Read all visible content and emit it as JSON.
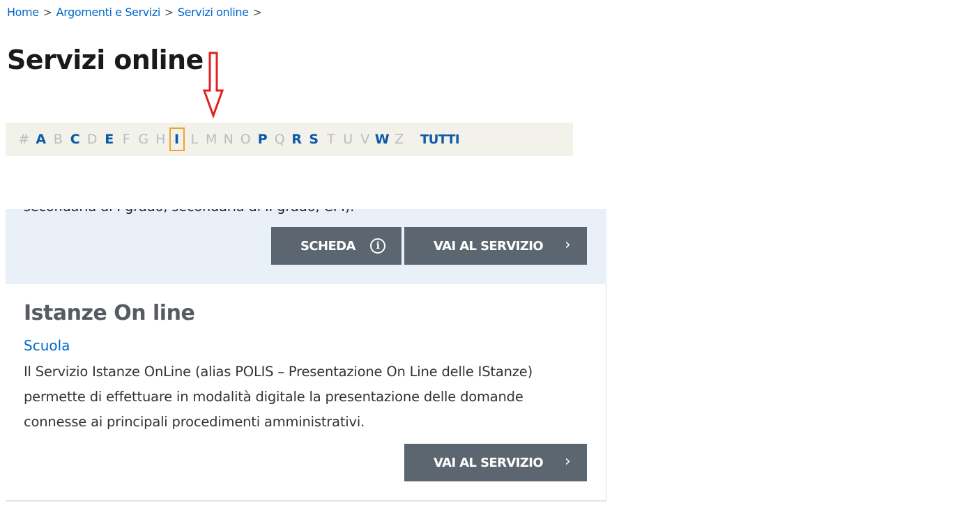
{
  "breadcrumb": {
    "items": [
      "Home",
      "Argomenti e Servizi",
      "Servizi online"
    ],
    "separator": ">"
  },
  "page": {
    "title": "Servizi online"
  },
  "alphabet": {
    "letters": [
      {
        "char": "#",
        "state": "inactive"
      },
      {
        "char": "A",
        "state": "active"
      },
      {
        "char": "B",
        "state": "inactive"
      },
      {
        "char": "C",
        "state": "active"
      },
      {
        "char": "D",
        "state": "inactive"
      },
      {
        "char": "E",
        "state": "active"
      },
      {
        "char": "F",
        "state": "inactive"
      },
      {
        "char": "G",
        "state": "inactive"
      },
      {
        "char": "H",
        "state": "inactive"
      },
      {
        "char": "I",
        "state": "selected"
      },
      {
        "char": "L",
        "state": "inactive"
      },
      {
        "char": "M",
        "state": "inactive"
      },
      {
        "char": "N",
        "state": "inactive"
      },
      {
        "char": "O",
        "state": "inactive"
      },
      {
        "char": "P",
        "state": "active"
      },
      {
        "char": "Q",
        "state": "inactive"
      },
      {
        "char": "R",
        "state": "active"
      },
      {
        "char": "S",
        "state": "active"
      },
      {
        "char": "T",
        "state": "inactive"
      },
      {
        "char": "U",
        "state": "inactive"
      },
      {
        "char": "V",
        "state": "inactive"
      },
      {
        "char": "W",
        "state": "active"
      },
      {
        "char": "Z",
        "state": "inactive"
      }
    ],
    "all_label": "TUTTI"
  },
  "annotation": {
    "icon": "red-down-arrow-icon",
    "color": "#e02020"
  },
  "card_previous": {
    "cut_text": "secondaria di I grado, secondaria di II grado, CPI).",
    "scheda_label": "SCHEDA",
    "scheda_icon": "info-icon",
    "vai_label": "VAI AL SERVIZIO",
    "vai_icon": "chevron-right-icon"
  },
  "card_istanze": {
    "title": "Istanze On line",
    "category": "Scuola",
    "description": "Il Servizio Istanze OnLine (alias POLIS – Presentazione On Line delle IStanze) permette di effettuare in modalità digitale la presentazione delle domande connesse ai principali procedimenti amministrativi.",
    "vai_label": "VAI AL SERVIZIO",
    "vai_icon": "chevron-right-icon"
  },
  "colors": {
    "link": "#0066cc",
    "button_bg": "#5c6670",
    "highlight_border": "#f0a22e",
    "card_bg": "#e9f0f8",
    "alpha_bg": "#f2f1ea"
  }
}
